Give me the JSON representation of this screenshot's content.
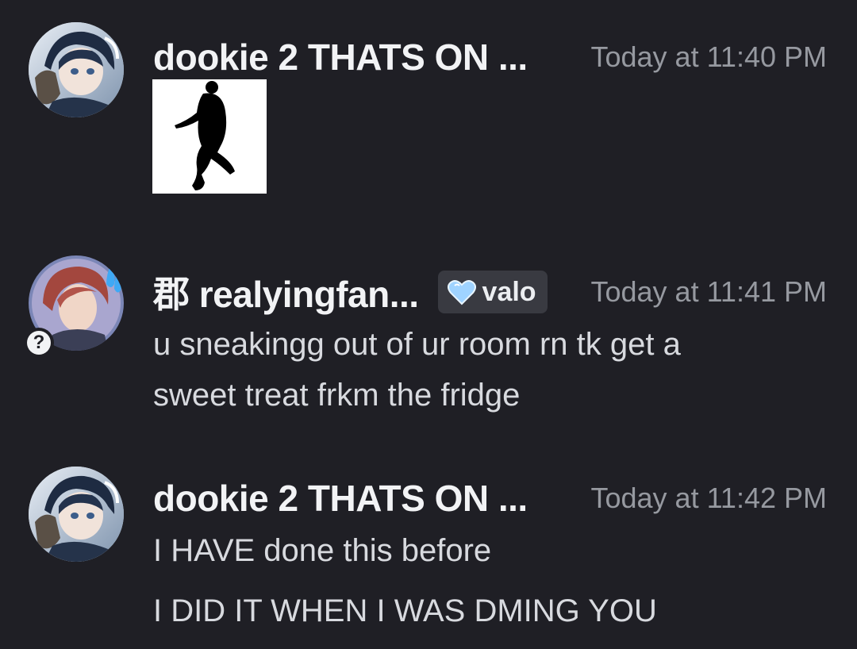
{
  "messages": [
    {
      "username": "dookie 2 THATS ON ...",
      "timestamp": "Today at 11:40 PM",
      "attachment": "dancing-silhouette-gif"
    },
    {
      "username": "郡 realyingfan...",
      "tag": {
        "icon": "heart-icon",
        "label": "valo"
      },
      "timestamp": "Today at 11:41 PM",
      "status": "?",
      "lines": [
        "u sneakingg out of ur room rn tk get a",
        "sweet treat frkm the fridge"
      ]
    },
    {
      "username": "dookie 2 THATS ON ...",
      "timestamp": "Today at 11:42 PM",
      "lines": [
        "I HAVE done this before",
        "I DID IT WHEN I WAS DMING YOU"
      ]
    }
  ],
  "colors": {
    "background": "#1f1f25",
    "username": "#f2f3f5",
    "timestamp": "#9699a0",
    "text": "#d8dadf",
    "tag_bg": "#393a41",
    "heart": "#9fd3ff"
  }
}
